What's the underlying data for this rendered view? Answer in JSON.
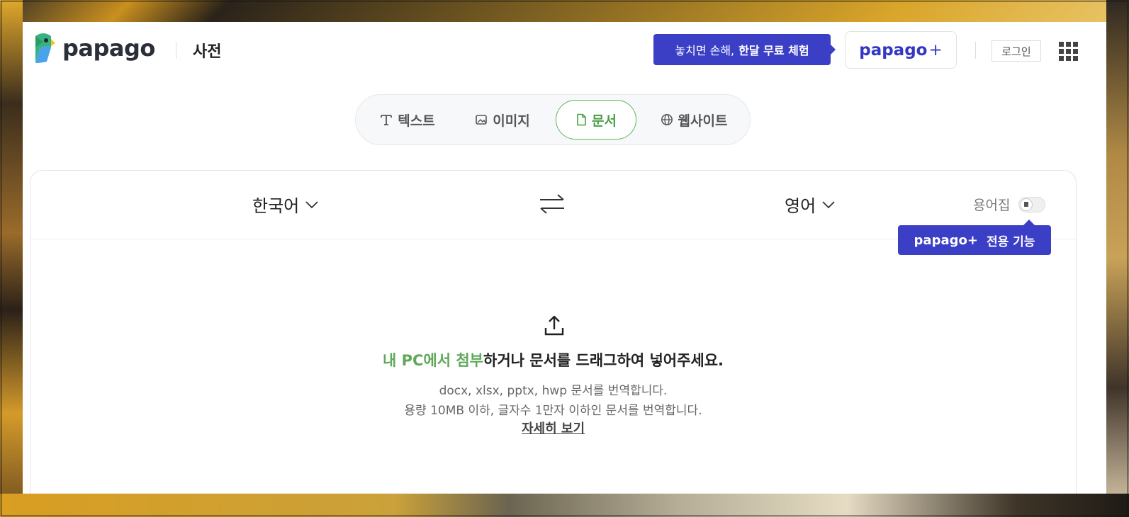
{
  "header": {
    "logo_text": "papago",
    "dictionary_link": "사전",
    "promo_prefix": "놓치면 손해,",
    "promo_bold": "한달 무료 체험",
    "plus_button_brand": "papago",
    "plus_button_symbol": "+",
    "login": "로그인"
  },
  "tabs": [
    {
      "label": "텍스트",
      "icon": "text-icon"
    },
    {
      "label": "이미지",
      "icon": "image-icon"
    },
    {
      "label": "문서",
      "icon": "document-icon",
      "active": true
    },
    {
      "label": "웹사이트",
      "icon": "globe-icon"
    }
  ],
  "panel": {
    "source_language": "한국어",
    "target_language": "영어",
    "glossary_label": "용어집",
    "tooltip_brand": "papago+",
    "tooltip_text": "전용 기능",
    "drop_green": "내 PC에서 첨부",
    "drop_rest": "하거나 문서를 드래그하여 넣어주세요.",
    "formats_line": "docx, xlsx, pptx, hwp 문서를 번역합니다.",
    "limit_line": "용량 10MB 이하, 글자수 1만자 이하인 문서를 번역합니다.",
    "detail_link": "자세히 보기"
  },
  "colors": {
    "accent_blue": "#3b3fc6",
    "active_green": "#5fa85a"
  }
}
